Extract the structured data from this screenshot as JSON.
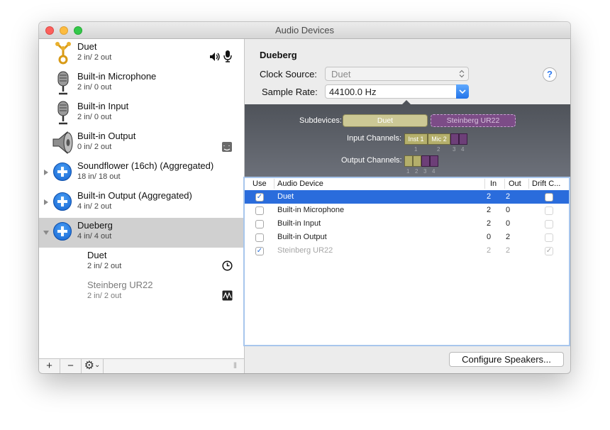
{
  "window": {
    "title": "Audio Devices"
  },
  "sidebar": {
    "devices": [
      {
        "name": "Duet",
        "io": "2 in/ 2 out",
        "icon": "firewire-icon",
        "right_icons": [
          "speaker-icon",
          "microphone-icon"
        ]
      },
      {
        "name": "Built-in Microphone",
        "io": "2 in/ 0 out",
        "icon": "microphone-icon"
      },
      {
        "name": "Built-in Input",
        "io": "2 in/ 0 out",
        "icon": "microphone-icon"
      },
      {
        "name": "Built-in Output",
        "io": "0 in/ 2 out",
        "icon": "speaker-icon",
        "right_icons": [
          "finder-icon"
        ]
      },
      {
        "name": "Soundflower (16ch) (Aggregated)",
        "io": "18 in/ 18 out",
        "icon": "aggregate-plus-icon"
      },
      {
        "name": "Built-in Output (Aggregated)",
        "io": "4 in/ 2 out",
        "icon": "aggregate-plus-icon"
      },
      {
        "name": "Dueberg",
        "io": "4 in/ 4 out",
        "icon": "aggregate-plus-icon",
        "selected": true
      },
      {
        "name": "Duet",
        "io": "2 in/ 2 out",
        "right_icons": [
          "clock-icon"
        ]
      },
      {
        "name": "Steinberg UR22",
        "io": "2 in/ 2 out",
        "right_icons": [
          "waveform-icon"
        ]
      }
    ],
    "footer": {
      "add": "+",
      "remove": "−",
      "gear": "⚙",
      "chevron": "⌄",
      "resize": "|||"
    }
  },
  "detail": {
    "device_name": "Dueberg",
    "clock_source_label": "Clock Source:",
    "clock_source_value": "Duet",
    "sample_rate_label": "Sample Rate:",
    "sample_rate_value": "44100.0 Hz",
    "help": "?",
    "subdevices_label": "Subdevices:",
    "subdevices": [
      "Duet",
      "Steinberg UR22"
    ],
    "input_channels_label": "Input Channels:",
    "input_channels": [
      "Inst 1",
      "Mic 2"
    ],
    "input_channel_numbers": [
      "1",
      "2",
      "3",
      "4"
    ],
    "output_channels_label": "Output Channels:",
    "output_channel_numbers": [
      "1",
      "2",
      "3",
      "4"
    ]
  },
  "table": {
    "headers": {
      "use": "Use",
      "device": "Audio Device",
      "in": "In",
      "out": "Out",
      "drift": "Drift C..."
    },
    "rows": [
      {
        "use": true,
        "device": "Duet",
        "in": "2",
        "out": "2",
        "drift": false,
        "selected": true
      },
      {
        "use": false,
        "device": "Built-in Microphone",
        "in": "2",
        "out": "0",
        "drift": false
      },
      {
        "use": false,
        "device": "Built-in Input",
        "in": "2",
        "out": "0",
        "drift": false
      },
      {
        "use": false,
        "device": "Built-in Output",
        "in": "0",
        "out": "2",
        "drift": false
      },
      {
        "use": true,
        "device": "Steinberg UR22",
        "in": "2",
        "out": "2",
        "drift": true,
        "disabled": true
      }
    ]
  },
  "configure_speakers": "Configure Speakers...",
  "colors": {
    "selection": "#2a6cdc",
    "accent": "#1664d2",
    "subdevice_duet": "#ccc895",
    "subdevice_steinberg": "#7c4c87"
  }
}
